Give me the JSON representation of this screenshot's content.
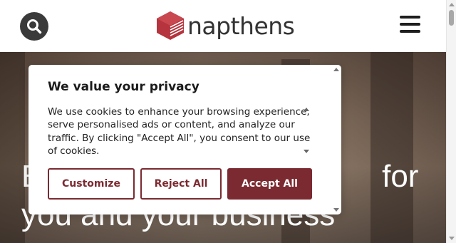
{
  "header": {
    "logo_text": "napthens",
    "brand_color": "#b5343d",
    "search_icon": "search-icon",
    "menu_icon": "hamburger-menu-icon"
  },
  "hero": {
    "heading_line1": "B                                       for",
    "heading_line2": "you and your business"
  },
  "cookie_banner": {
    "title": "We value your privacy",
    "body": "We use cookies to enhance your browsing experience, serve personalised ads or content, and analyze our traffic. By clicking \"Accept All\", you consent to our use of cookies.",
    "customize_label": "Customize",
    "reject_label": "Reject All",
    "accept_label": "Accept All",
    "accent_color": "#7b2a31"
  }
}
